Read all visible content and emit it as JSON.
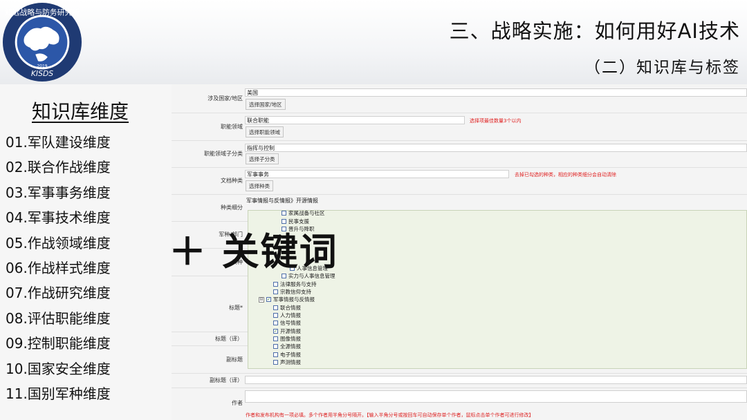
{
  "header": {
    "title": "三、战略实施：如何用好AI技术",
    "subtitle": "（二）知识库与标签",
    "logo": {
      "text_top": "知远战略与防务研究所",
      "text_bottom": "KISDS",
      "year": "2019"
    }
  },
  "left_panel": {
    "title": "知识库维度",
    "items": [
      "01.军队建设维度",
      "02.联合作战维度",
      "03.军事事务维度",
      "04.军事技术维度",
      "05.作战领域维度",
      "06.作战样式维度",
      "07.作战研究维度",
      "08.评估职能维度",
      "09.控制职能维度",
      "10.国家安全维度",
      "11.国别军种维度"
    ]
  },
  "form": {
    "rows": {
      "country": {
        "label": "涉及国家/地区",
        "value": "美国",
        "button": "选择国家/地区"
      },
      "function": {
        "label": "职能领域",
        "value": "联合职能",
        "button": "选择职能领域",
        "note": "选择项最佳数量3个以内"
      },
      "subclass": {
        "label": "职能领域子分类",
        "value": "指挥与控制",
        "button": "选择子分类"
      },
      "doctype": {
        "label": "文档种类",
        "value": "军事事务",
        "button": "选择种类",
        "note": "去掉已勾选的种类，相应的种类细分会自动清除"
      },
      "subtype": {
        "label": "种类细分",
        "value": "军事情报与反情报》开源情报"
      },
      "service": {
        "label": "军种/部门"
      },
      "arms": {
        "label": "兵种"
      },
      "title": {
        "label": "标题*"
      },
      "title_en": {
        "label": "标题（译）"
      },
      "subtitle": {
        "label": "副标题"
      },
      "subtitle_en": {
        "label": "副标题（译）"
      },
      "author": {
        "label": "作者"
      }
    },
    "tree_items": [
      {
        "text": "家属战备与社区",
        "checked": false
      },
      {
        "text": "民事支援",
        "checked": false
      },
      {
        "text": "晋升与降职",
        "checked": false
      },
      {
        "text": "人事信息管理",
        "checked": false
      },
      {
        "text": "实力与人事信息管理",
        "checked": false
      },
      {
        "text": "法律服务与支持",
        "checked": false
      },
      {
        "text": "宗教信仰支持",
        "checked": false
      },
      {
        "text": "军事情报与反情报",
        "checked": true
      },
      {
        "text": "联合情报",
        "checked": false
      },
      {
        "text": "人力情报",
        "checked": false
      },
      {
        "text": "信号情报",
        "checked": false
      },
      {
        "text": "开源情报",
        "checked": true
      },
      {
        "text": "图像情报",
        "checked": false
      },
      {
        "text": "全源情报",
        "checked": false
      },
      {
        "text": "电子情报",
        "checked": false
      },
      {
        "text": "声测情报",
        "checked": false
      }
    ],
    "tree_collapse_glyph": "⊟",
    "check_glyph": "✓",
    "author_note": "作者和发布机构有一项必填。多个作者用半角分号隔开。【输入半角分号或按回车可自动保存单个作者，鼠标点击单个作者可进行修改】"
  },
  "overlay": {
    "text": "＋ 关键词"
  },
  "colors": {
    "tree_bg": "#eef3e6",
    "note_red": "#e02020",
    "logo_blue": "#1f3a73"
  }
}
